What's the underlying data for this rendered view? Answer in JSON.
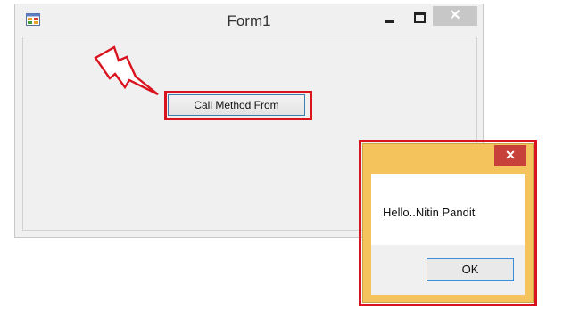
{
  "main_window": {
    "title": "Form1",
    "icon": "app-form-icon",
    "controls": {
      "minimize": "minimize-icon",
      "maximize": "maximize-icon",
      "close_label": "✕"
    },
    "button_label": "Call Method From"
  },
  "message_box": {
    "close_label": "✕",
    "message": "Hello..Nitin Pandit",
    "ok_label": "OK"
  },
  "annotations": {
    "highlight_color": "#d9141e",
    "arrow": "lightning-bolt-icon"
  }
}
